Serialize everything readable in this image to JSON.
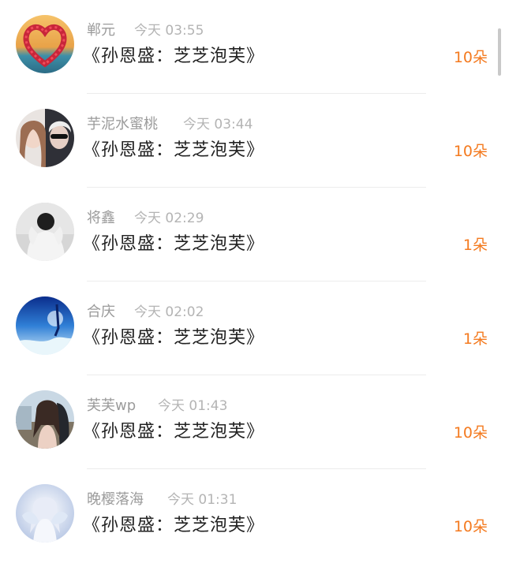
{
  "records": [
    {
      "name": "郸元",
      "time": "今天 03:55",
      "message": "《孙恩盛：芝芝泡芙》",
      "count": "10朵",
      "avatar_icon": "heart-flowers-avatar"
    },
    {
      "name": "芋泥水蜜桃",
      "time": "今天 03:44",
      "message": "《孙恩盛：芝芝泡芙》",
      "count": "10朵",
      "avatar_icon": "couple-photo-avatar"
    },
    {
      "name": "将鑫",
      "time": "今天 02:29",
      "message": "《孙恩盛：芝芝泡芙》",
      "count": "1朵",
      "avatar_icon": "bw-person-avatar"
    },
    {
      "name": "合庆",
      "time": "今天 02:02",
      "message": "《孙恩盛：芝芝泡芙》",
      "count": "1朵",
      "avatar_icon": "moon-festival-avatar"
    },
    {
      "name": "芙芙wp",
      "time": "今天 01:43",
      "message": "《孙恩盛：芝芝泡芙》",
      "count": "10朵",
      "avatar_icon": "girl-photo-avatar"
    },
    {
      "name": "晚樱落海",
      "time": "今天 01:31",
      "message": "《孙恩盛：芝芝泡芙》",
      "count": "10朵",
      "avatar_icon": "angel-art-avatar"
    }
  ],
  "colors": {
    "name": "#9b9b9b",
    "time": "#b4b4b4",
    "message": "#222222",
    "count": "#f47a1f",
    "divider": "#ececec"
  }
}
